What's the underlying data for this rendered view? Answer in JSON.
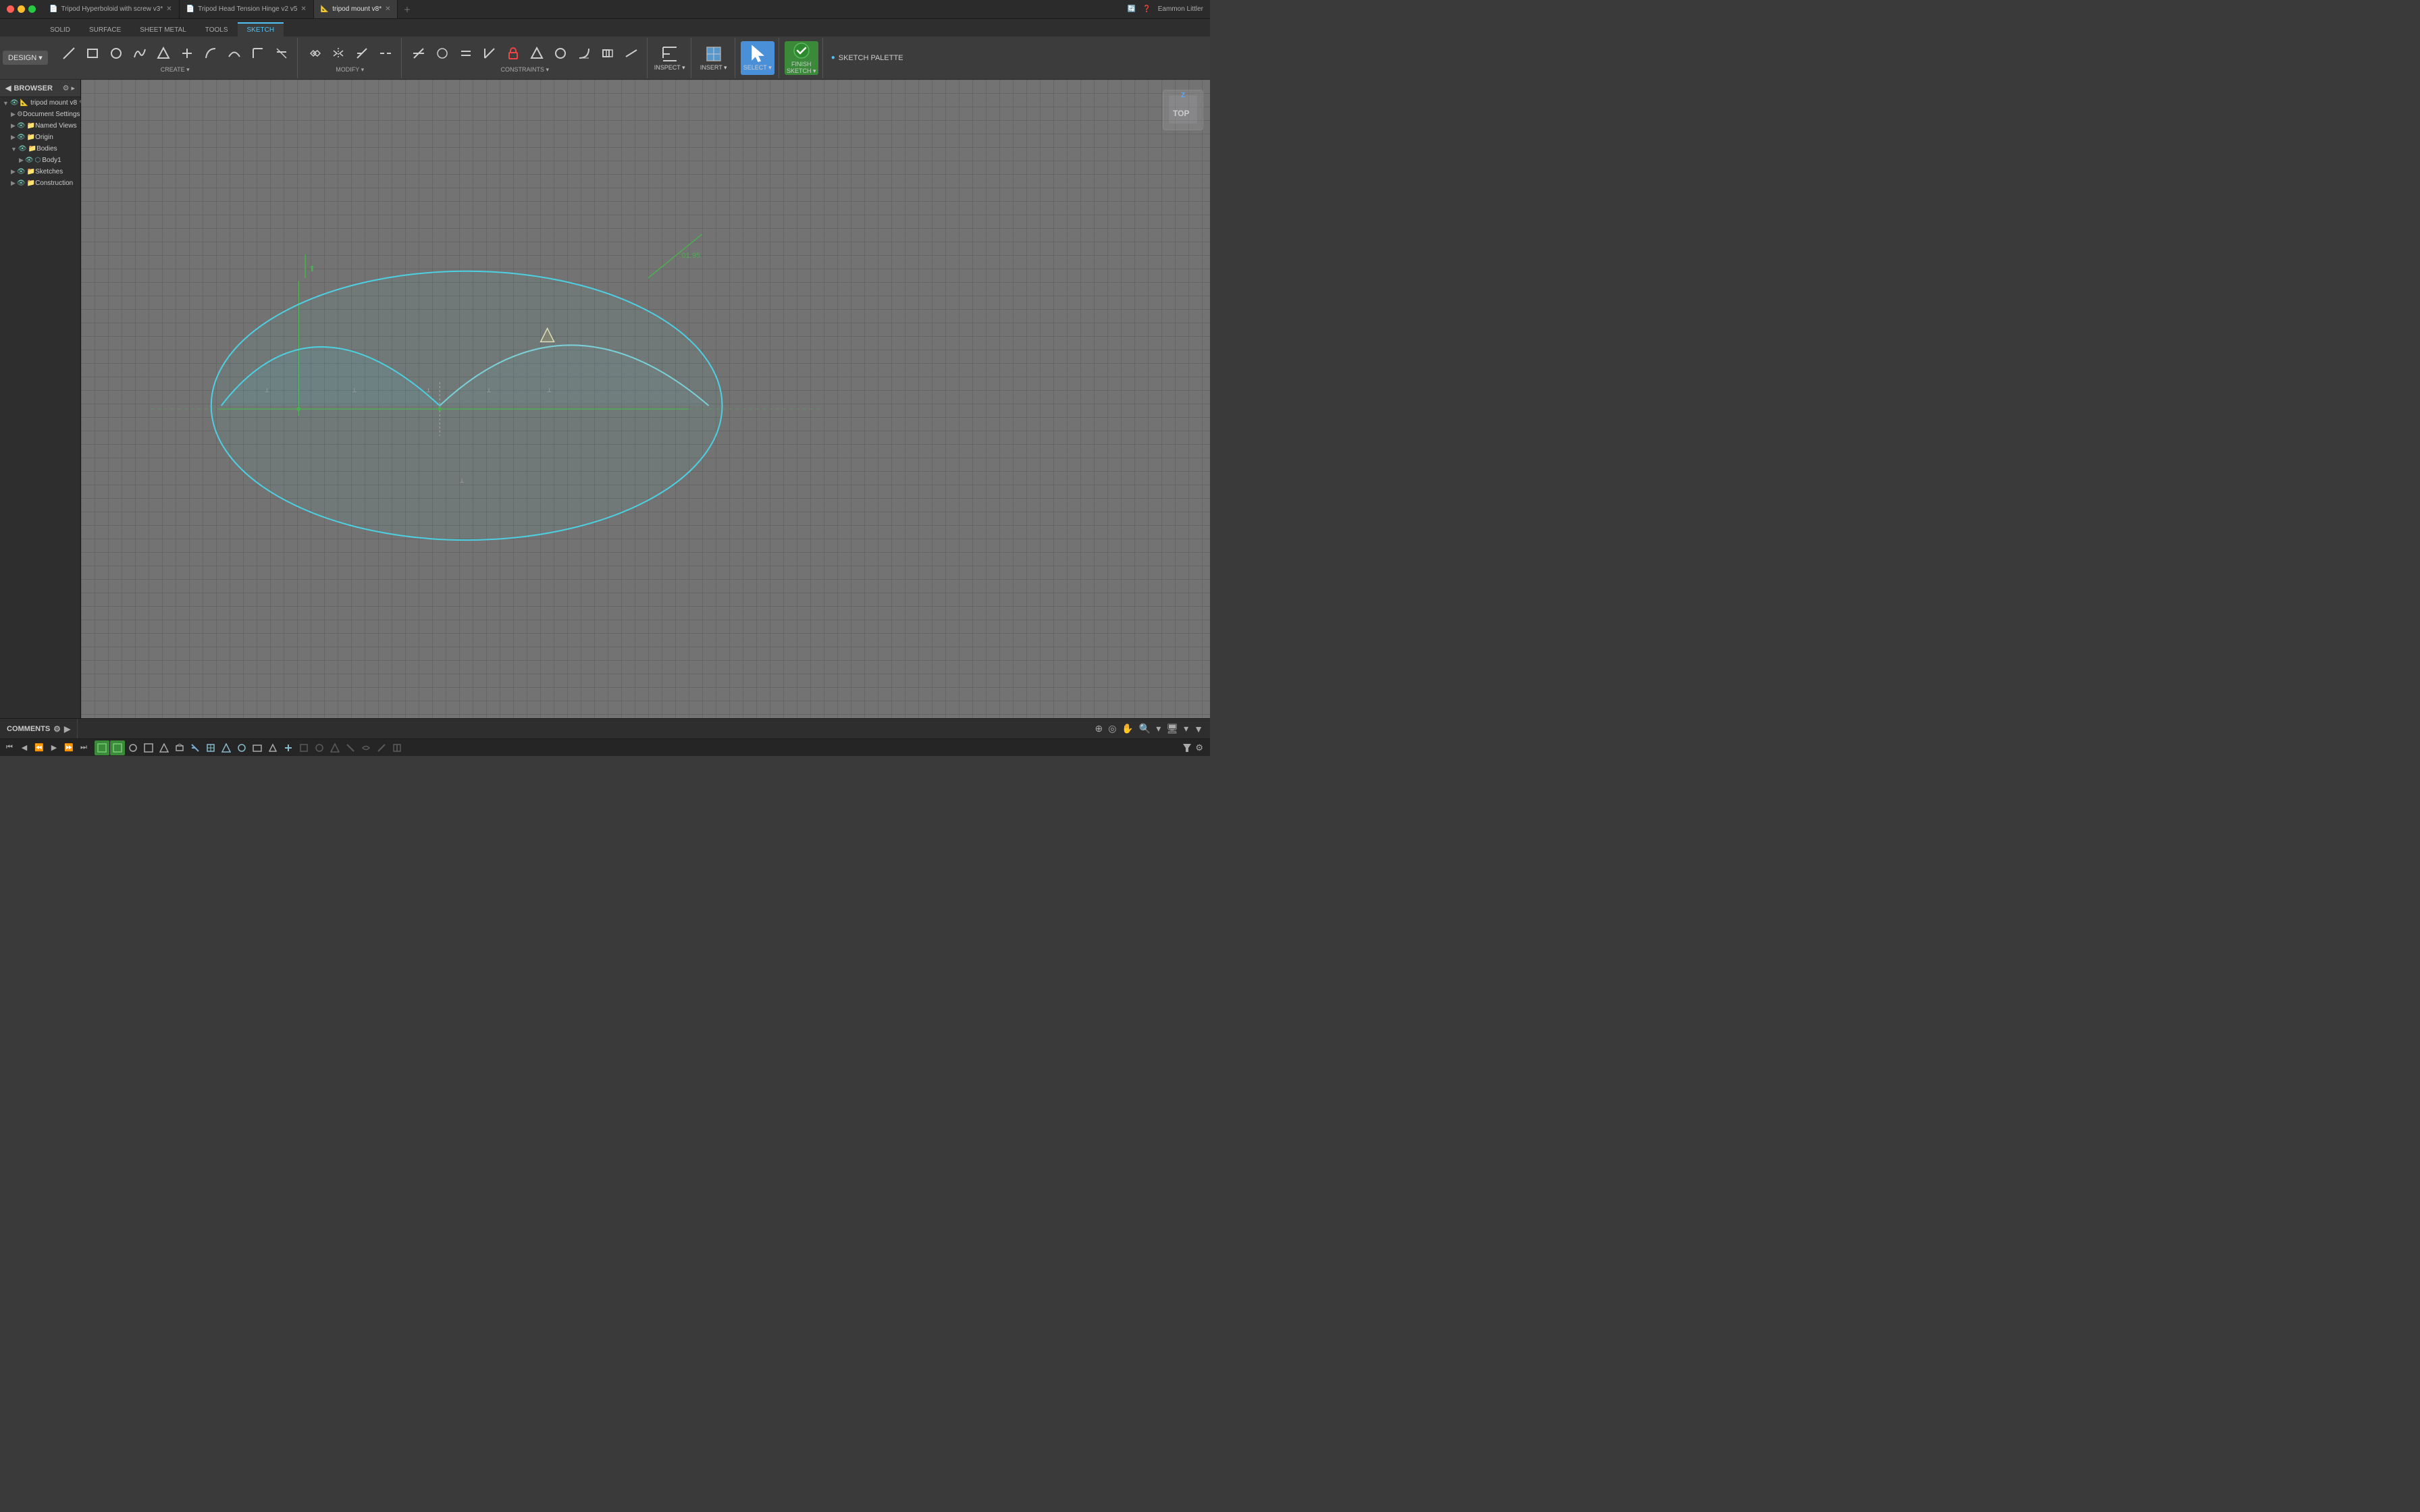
{
  "titlebar": {
    "tabs": [
      {
        "label": "Tripod Hyperboloid with screw v3*",
        "active": false,
        "icon": "📄"
      },
      {
        "label": "Tripod Head Tension Hinge v2 v5",
        "active": false,
        "icon": "📄"
      },
      {
        "label": "tripod mount v8*",
        "active": true,
        "icon": "📐"
      }
    ],
    "user": "Eammon Littler"
  },
  "toolbar": {
    "design_label": "DESIGN",
    "tabs": [
      "SOLID",
      "SURFACE",
      "SHEET METAL",
      "TOOLS",
      "SKETCH"
    ],
    "active_tab": "SKETCH",
    "groups": {
      "create": {
        "label": "CREATE",
        "tools": [
          "line",
          "rectangle",
          "circle",
          "spline",
          "polygon",
          "line2",
          "arc1",
          "arc2",
          "arc3",
          "trim"
        ]
      },
      "modify": {
        "label": "MODIFY"
      },
      "constraints": {
        "label": "CONSTRAINTS"
      },
      "inspect": {
        "label": "INSPECT"
      },
      "insert": {
        "label": "INSERT"
      },
      "select": {
        "label": "SELECT"
      },
      "finish_sketch": {
        "label": "FINISH SKETCH"
      }
    },
    "sketch_palette": "SKETCH PALETTE"
  },
  "browser": {
    "title": "BROWSER",
    "tree": [
      {
        "id": "root",
        "label": "tripod mount v8",
        "level": 0,
        "expanded": true,
        "type": "root"
      },
      {
        "id": "doc-settings",
        "label": "Document Settings",
        "level": 1,
        "expanded": false,
        "type": "settings"
      },
      {
        "id": "named-views",
        "label": "Named Views",
        "level": 1,
        "expanded": false,
        "type": "folder"
      },
      {
        "id": "origin",
        "label": "Origin",
        "level": 1,
        "expanded": false,
        "type": "folder"
      },
      {
        "id": "bodies",
        "label": "Bodies",
        "level": 1,
        "expanded": true,
        "type": "folder"
      },
      {
        "id": "body1",
        "label": "Body1",
        "level": 2,
        "expanded": false,
        "type": "body"
      },
      {
        "id": "sketches",
        "label": "Sketches",
        "level": 1,
        "expanded": false,
        "type": "folder"
      },
      {
        "id": "construction",
        "label": "Construction",
        "level": 1,
        "expanded": false,
        "type": "folder"
      }
    ]
  },
  "canvas": {
    "dimension_label1": "01.95",
    "view_cube_label": "TOP"
  },
  "comments": {
    "label": "COMMENTS"
  },
  "statusbar": {
    "icons": [
      "home",
      "play-back",
      "step-back",
      "play",
      "step-forward",
      "play-forward"
    ]
  }
}
